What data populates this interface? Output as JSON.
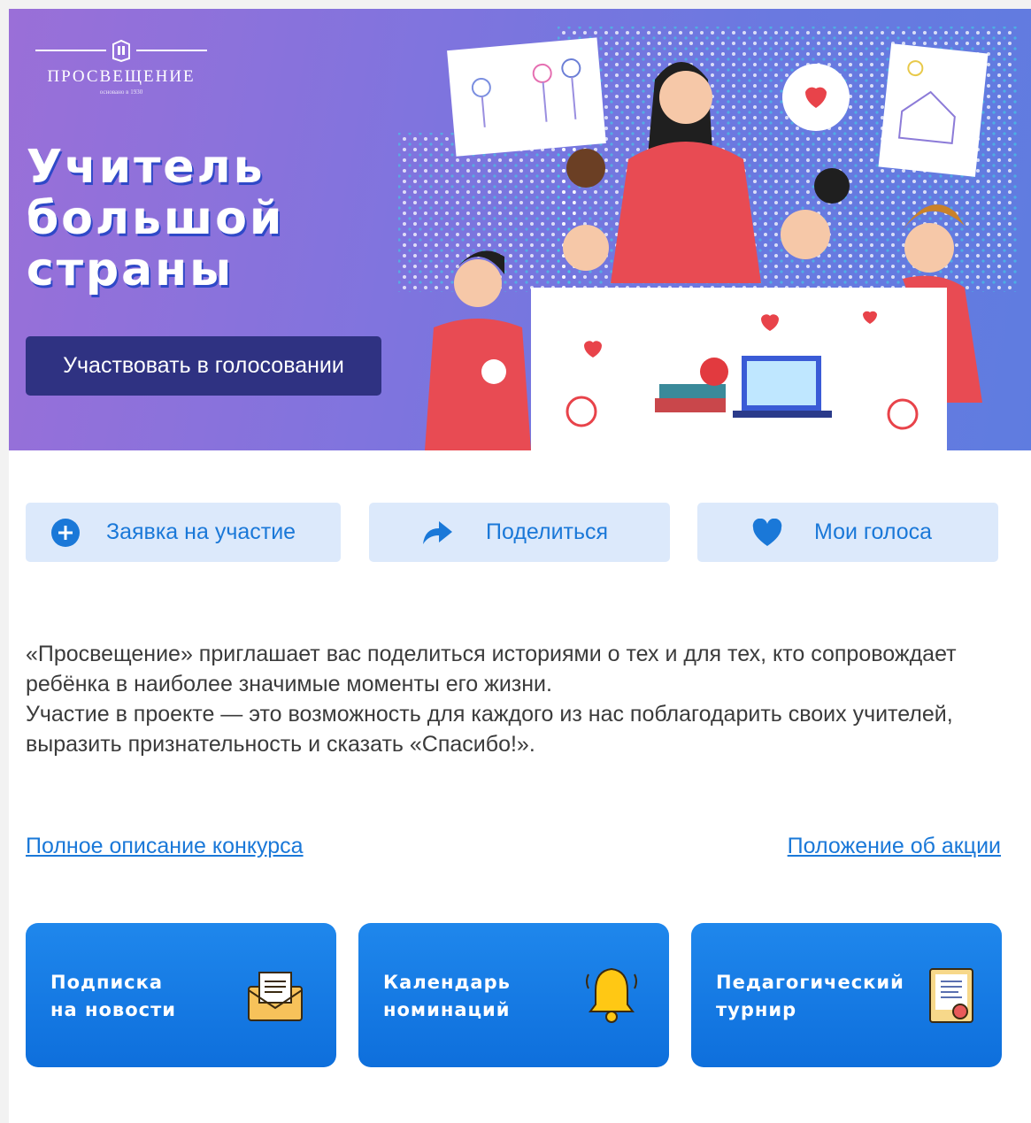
{
  "logo": {
    "name": "ПРОСВЕЩЕНИЕ",
    "subtitle": "основано в 1930"
  },
  "hero": {
    "title_lines": [
      "Учитель",
      "большой",
      "страны"
    ],
    "vote_button": "Участвовать в голосовании"
  },
  "actions": {
    "apply": "Заявка на участие",
    "share": "Поделиться",
    "votes": "Мои голоса"
  },
  "description": {
    "paragraph1": "«Просвещение» приглашает вас поделиться историями о тех и для тех, кто сопровождает ребёнка в наиболее значимые моменты его жизни.",
    "paragraph2": "Участие в проекте — это возможность для каждого из нас поблагодарить своих учителей, выразить признательность и сказать «Спасибо!»."
  },
  "links": {
    "full_description": "Полное описание конкурса",
    "regulations": "Положение об акции"
  },
  "cards": [
    {
      "line1": "Подписка",
      "line2": "на новости",
      "icon": "envelope-icon"
    },
    {
      "line1": "Календарь",
      "line2": "номинаций",
      "icon": "bell-icon"
    },
    {
      "line1": "Педагогический",
      "line2": "турнир",
      "icon": "certificate-icon"
    }
  ],
  "colors": {
    "accent": "#1a78d8",
    "action_bg": "#dce9fb",
    "vote_button_bg": "#2f3282",
    "card_bg": "#1479e3",
    "hero_gradient_start": "#9a6fd8",
    "hero_gradient_end": "#5f7ce0"
  }
}
